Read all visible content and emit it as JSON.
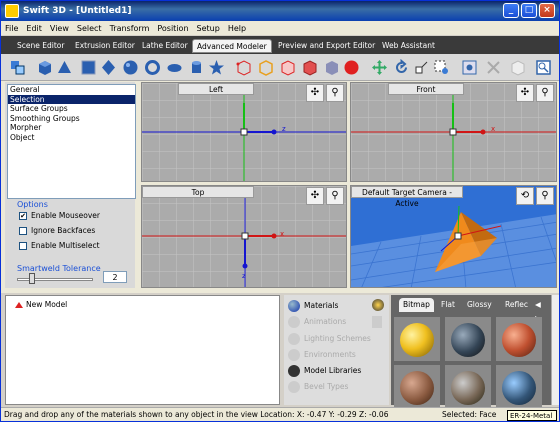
{
  "window": {
    "title": "Swift 3D - [Untitled1]",
    "min": "_",
    "max": "□",
    "close": "×"
  },
  "menu": [
    "File",
    "Edit",
    "View",
    "Select",
    "Transform",
    "Position",
    "Setup",
    "Help"
  ],
  "tabs": [
    {
      "label": "Scene Editor"
    },
    {
      "label": "Extrusion Editor"
    },
    {
      "label": "Lathe Editor"
    },
    {
      "label": "Advanced Modeler",
      "active": true
    },
    {
      "label": "Preview and Export Editor"
    },
    {
      "label": "Web Assistant"
    }
  ],
  "leftpanel": {
    "list": [
      "General",
      "Selection",
      "Surface Groups",
      "Smoothing Groups",
      "Morpher",
      "Object"
    ],
    "selected": "Selection",
    "options_title": "Options",
    "options": [
      {
        "label": "Enable Mouseover",
        "checked": true
      },
      {
        "label": "Ignore Backfaces",
        "checked": false
      },
      {
        "label": "Enable Multiselect",
        "checked": false
      }
    ],
    "smartweld_label": "Smartweld Tolerance",
    "smartweld_value": "2",
    "smartweld_fraction": 0.2
  },
  "viewports": {
    "left": "Left",
    "front": "Front",
    "top": "Top",
    "camera": "Default Target Camera - Active"
  },
  "tree": {
    "node": "New Model"
  },
  "materials_menu": [
    {
      "label": "Materials",
      "enabled": true
    },
    {
      "label": "Animations",
      "enabled": false
    },
    {
      "label": "Lighting Schemes",
      "enabled": false
    },
    {
      "label": "Environments",
      "enabled": false
    },
    {
      "label": "Model Libraries",
      "enabled": true
    },
    {
      "label": "Bevel Types",
      "enabled": false
    }
  ],
  "material_tabs": [
    {
      "label": "Bitmap",
      "active": true
    },
    {
      "label": "Flat"
    },
    {
      "label": "Glossy"
    },
    {
      "label": "Reflec"
    }
  ],
  "status": {
    "text": "Drag and drop any of the materials shown to any object in the view Location: X: -0.47  Y: -0.29  Z: -0.06",
    "selected": "Selected: Face",
    "tooltip": "ER-24-Metal"
  },
  "colors": {
    "accent": "#0a246a",
    "x_axis": "#e01010",
    "y_axis": "#10c010",
    "z_axis": "#1010e0",
    "pyramid": "#f08a1c"
  }
}
